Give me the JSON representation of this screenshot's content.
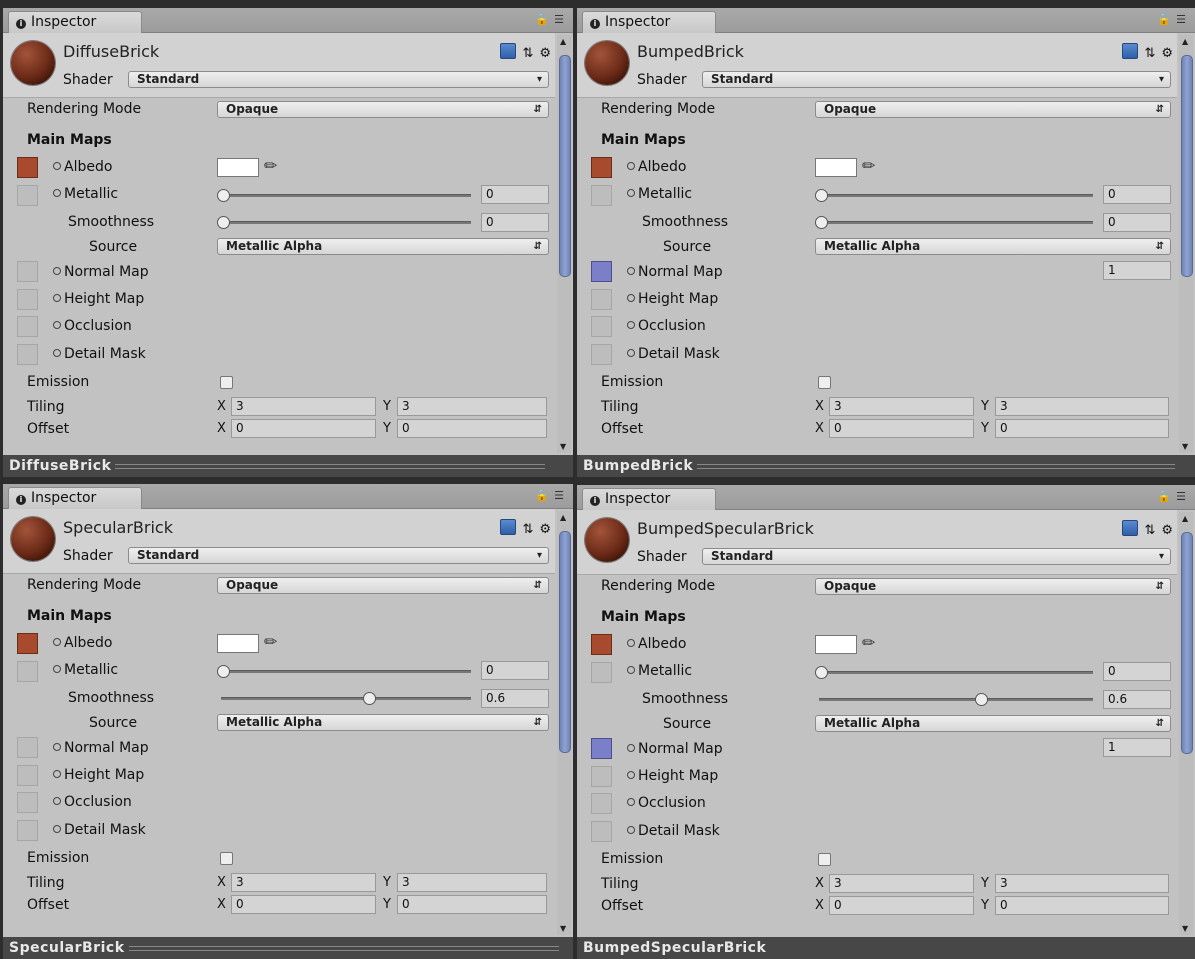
{
  "tab_label": "Inspector",
  "labels": {
    "shader": "Shader",
    "rendering_mode": "Rendering Mode",
    "main_maps": "Main Maps",
    "albedo": "Albedo",
    "metallic": "Metallic",
    "smoothness": "Smoothness",
    "source": "Source",
    "normal_map": "Normal Map",
    "height_map": "Height Map",
    "occlusion": "Occlusion",
    "detail_mask": "Detail Mask",
    "emission": "Emission",
    "tiling": "Tiling",
    "offset": "Offset",
    "x": "X",
    "y": "Y"
  },
  "colors": {
    "albedo_texture": "#a84a2e",
    "normal_texture": "#7b7ec8",
    "footer_bg": "#474747",
    "panel_bg": "#c2c2c2"
  },
  "panels": [
    {
      "material_name": "DiffuseBrick",
      "shader": "Standard",
      "rendering_mode": "Opaque",
      "metallic": "0",
      "smoothness": "0",
      "smoothness_fraction": 0,
      "source": "Metallic Alpha",
      "normal_scale": "",
      "tiling_x": "3",
      "tiling_y": "3",
      "offset_x": "0",
      "offset_y": "0",
      "footer": "DiffuseBrick"
    },
    {
      "material_name": "BumpedBrick",
      "shader": "Standard",
      "rendering_mode": "Opaque",
      "metallic": "0",
      "smoothness": "0",
      "smoothness_fraction": 0,
      "source": "Metallic Alpha",
      "normal_scale": "1",
      "tiling_x": "3",
      "tiling_y": "3",
      "offset_x": "0",
      "offset_y": "0",
      "footer": "BumpedBrick"
    },
    {
      "material_name": "SpecularBrick",
      "shader": "Standard",
      "rendering_mode": "Opaque",
      "metallic": "0",
      "smoothness": "0.6",
      "smoothness_fraction": 0.6,
      "source": "Metallic Alpha",
      "normal_scale": "",
      "tiling_x": "3",
      "tiling_y": "3",
      "offset_x": "0",
      "offset_y": "0",
      "footer": "SpecularBrick"
    },
    {
      "material_name": "BumpedSpecularBrick",
      "shader": "Standard",
      "rendering_mode": "Opaque",
      "metallic": "0",
      "smoothness": "0.6",
      "smoothness_fraction": 0.6,
      "source": "Metallic Alpha",
      "normal_scale": "1",
      "tiling_x": "3",
      "tiling_y": "3",
      "offset_x": "0",
      "offset_y": "0",
      "footer": "BumpedSpecularBrick"
    }
  ]
}
